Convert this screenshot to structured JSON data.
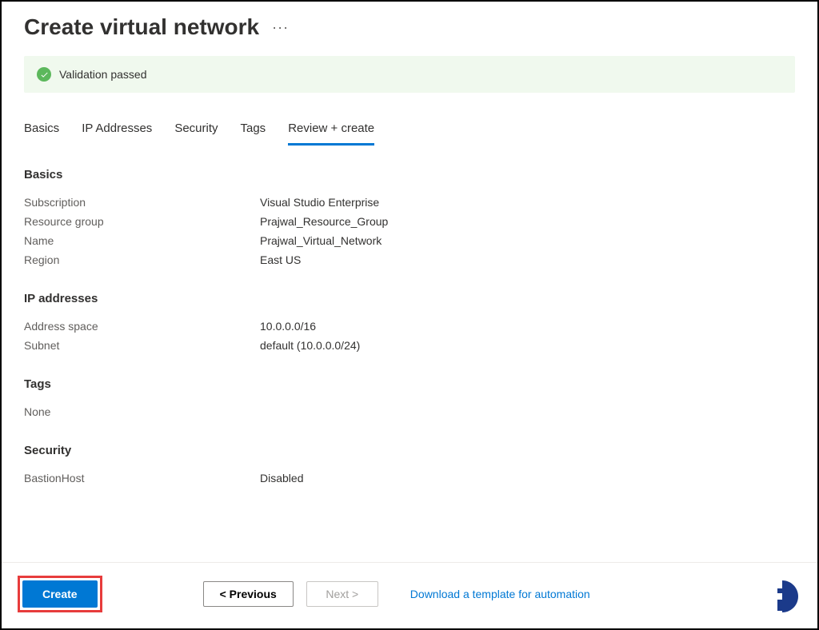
{
  "header": {
    "title": "Create virtual network",
    "ellipsis": "···"
  },
  "validation": {
    "message": "Validation passed"
  },
  "tabs": [
    {
      "label": "Basics",
      "active": false
    },
    {
      "label": "IP Addresses",
      "active": false
    },
    {
      "label": "Security",
      "active": false
    },
    {
      "label": "Tags",
      "active": false
    },
    {
      "label": "Review + create",
      "active": true
    }
  ],
  "sections": {
    "basics": {
      "title": "Basics",
      "rows": [
        {
          "label": "Subscription",
          "value": "Visual Studio Enterprise"
        },
        {
          "label": "Resource group",
          "value": "Prajwal_Resource_Group"
        },
        {
          "label": "Name",
          "value": "Prajwal_Virtual_Network"
        },
        {
          "label": "Region",
          "value": "East US"
        }
      ]
    },
    "ip": {
      "title": "IP addresses",
      "rows": [
        {
          "label": "Address space",
          "value": "10.0.0.0/16"
        },
        {
          "label": "Subnet",
          "value": "default (10.0.0.0/24)"
        }
      ]
    },
    "tags": {
      "title": "Tags",
      "none": "None"
    },
    "security": {
      "title": "Security",
      "rows": [
        {
          "label": "BastionHost",
          "value": "Disabled"
        }
      ]
    }
  },
  "footer": {
    "create": "Create",
    "previous": "< Previous",
    "next": "Next >",
    "download": "Download a template for automation"
  }
}
